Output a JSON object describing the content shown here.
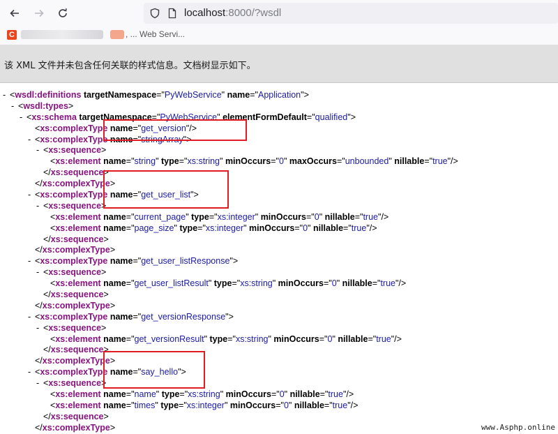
{
  "browser": {
    "url_host": "localhost",
    "url_rest": ":8000/?wsdl",
    "bookmark_text": ", ... Web Servi..."
  },
  "notice": "该 XML 文件并未包含任何关联的样式信息。文档树显示如下。",
  "xml_lines": [
    {
      "indent": 0,
      "toggle": "-",
      "open": "<",
      "tag": "wsdl:definitions",
      "attrs": [
        [
          "targetNamespace",
          "PyWebService"
        ],
        [
          "name",
          "Application"
        ]
      ],
      "close": ">"
    },
    {
      "indent": 1,
      "toggle": "-",
      "open": "<",
      "tag": "wsdl:types",
      "attrs": [],
      "close": ">"
    },
    {
      "indent": 2,
      "toggle": "-",
      "open": "<",
      "tag": "xs:schema",
      "attrs": [
        [
          "targetNamespace",
          "PyWebService"
        ],
        [
          "elementFormDefault",
          "qualified"
        ]
      ],
      "close": ">"
    },
    {
      "indent": 3,
      "toggle": "",
      "open": "<",
      "tag": "xs:complexType",
      "attrs": [
        [
          "name",
          "get_version"
        ]
      ],
      "close": "/>"
    },
    {
      "indent": 3,
      "toggle": "-",
      "open": "<",
      "tag": "xs:complexType",
      "attrs": [
        [
          "name",
          "stringArray"
        ]
      ],
      "close": ">"
    },
    {
      "indent": 4,
      "toggle": "-",
      "open": "<",
      "tag": "xs:sequence",
      "attrs": [],
      "close": ">"
    },
    {
      "indent": 5,
      "toggle": "",
      "open": "<",
      "tag": "xs:element",
      "attrs": [
        [
          "name",
          "string"
        ],
        [
          "type",
          "xs:string"
        ],
        [
          "minOccurs",
          "0"
        ],
        [
          "maxOccurs",
          "unbounded"
        ],
        [
          "nillable",
          "true"
        ]
      ],
      "close": "/>"
    },
    {
      "indent": 4,
      "toggle": "",
      "open": "</",
      "tag": "xs:sequence",
      "attrs": [],
      "close": ">"
    },
    {
      "indent": 3,
      "toggle": "",
      "open": "</",
      "tag": "xs:complexType",
      "attrs": [],
      "close": ">"
    },
    {
      "indent": 3,
      "toggle": "-",
      "open": "<",
      "tag": "xs:complexType",
      "attrs": [
        [
          "name",
          "get_user_list"
        ]
      ],
      "close": ">"
    },
    {
      "indent": 4,
      "toggle": "-",
      "open": "<",
      "tag": "xs:sequence",
      "attrs": [],
      "close": ">"
    },
    {
      "indent": 5,
      "toggle": "",
      "open": "<",
      "tag": "xs:element",
      "attrs": [
        [
          "name",
          "current_page"
        ],
        [
          "type",
          "xs:integer"
        ],
        [
          "minOccurs",
          "0"
        ],
        [
          "nillable",
          "true"
        ]
      ],
      "close": "/>"
    },
    {
      "indent": 5,
      "toggle": "",
      "open": "<",
      "tag": "xs:element",
      "attrs": [
        [
          "name",
          "page_size"
        ],
        [
          "type",
          "xs:integer"
        ],
        [
          "minOccurs",
          "0"
        ],
        [
          "nillable",
          "true"
        ]
      ],
      "close": "/>"
    },
    {
      "indent": 4,
      "toggle": "",
      "open": "</",
      "tag": "xs:sequence",
      "attrs": [],
      "close": ">"
    },
    {
      "indent": 3,
      "toggle": "",
      "open": "</",
      "tag": "xs:complexType",
      "attrs": [],
      "close": ">"
    },
    {
      "indent": 3,
      "toggle": "-",
      "open": "<",
      "tag": "xs:complexType",
      "attrs": [
        [
          "name",
          "get_user_listResponse"
        ]
      ],
      "close": ">"
    },
    {
      "indent": 4,
      "toggle": "-",
      "open": "<",
      "tag": "xs:sequence",
      "attrs": [],
      "close": ">"
    },
    {
      "indent": 5,
      "toggle": "",
      "open": "<",
      "tag": "xs:element",
      "attrs": [
        [
          "name",
          "get_user_listResult"
        ],
        [
          "type",
          "xs:string"
        ],
        [
          "minOccurs",
          "0"
        ],
        [
          "nillable",
          "true"
        ]
      ],
      "close": "/>"
    },
    {
      "indent": 4,
      "toggle": "",
      "open": "</",
      "tag": "xs:sequence",
      "attrs": [],
      "close": ">"
    },
    {
      "indent": 3,
      "toggle": "",
      "open": "</",
      "tag": "xs:complexType",
      "attrs": [],
      "close": ">"
    },
    {
      "indent": 3,
      "toggle": "-",
      "open": "<",
      "tag": "xs:complexType",
      "attrs": [
        [
          "name",
          "get_versionResponse"
        ]
      ],
      "close": ">"
    },
    {
      "indent": 4,
      "toggle": "-",
      "open": "<",
      "tag": "xs:sequence",
      "attrs": [],
      "close": ">"
    },
    {
      "indent": 5,
      "toggle": "",
      "open": "<",
      "tag": "xs:element",
      "attrs": [
        [
          "name",
          "get_versionResult"
        ],
        [
          "type",
          "xs:string"
        ],
        [
          "minOccurs",
          "0"
        ],
        [
          "nillable",
          "true"
        ]
      ],
      "close": "/>"
    },
    {
      "indent": 4,
      "toggle": "",
      "open": "</",
      "tag": "xs:sequence",
      "attrs": [],
      "close": ">"
    },
    {
      "indent": 3,
      "toggle": "",
      "open": "</",
      "tag": "xs:complexType",
      "attrs": [],
      "close": ">"
    },
    {
      "indent": 3,
      "toggle": "-",
      "open": "<",
      "tag": "xs:complexType",
      "attrs": [
        [
          "name",
          "say_hello"
        ]
      ],
      "close": ">"
    },
    {
      "indent": 4,
      "toggle": "-",
      "open": "<",
      "tag": "xs:sequence",
      "attrs": [],
      "close": ">"
    },
    {
      "indent": 5,
      "toggle": "",
      "open": "<",
      "tag": "xs:element",
      "attrs": [
        [
          "name",
          "name"
        ],
        [
          "type",
          "xs:string"
        ],
        [
          "minOccurs",
          "0"
        ],
        [
          "nillable",
          "true"
        ]
      ],
      "close": "/>"
    },
    {
      "indent": 5,
      "toggle": "",
      "open": "<",
      "tag": "xs:element",
      "attrs": [
        [
          "name",
          "times"
        ],
        [
          "type",
          "xs:integer"
        ],
        [
          "minOccurs",
          "0"
        ],
        [
          "nillable",
          "true"
        ]
      ],
      "close": "/>"
    },
    {
      "indent": 4,
      "toggle": "",
      "open": "</",
      "tag": "xs:sequence",
      "attrs": [],
      "close": ">"
    },
    {
      "indent": 3,
      "toggle": "",
      "open": "</",
      "tag": "xs:complexType",
      "attrs": [],
      "close": ">"
    }
  ],
  "watermark": "www.Asphp.online",
  "colors": {
    "tag": "#881280",
    "value": "#1a1aa6",
    "highlight": "#e01b24",
    "favicon": "#e8471e"
  }
}
